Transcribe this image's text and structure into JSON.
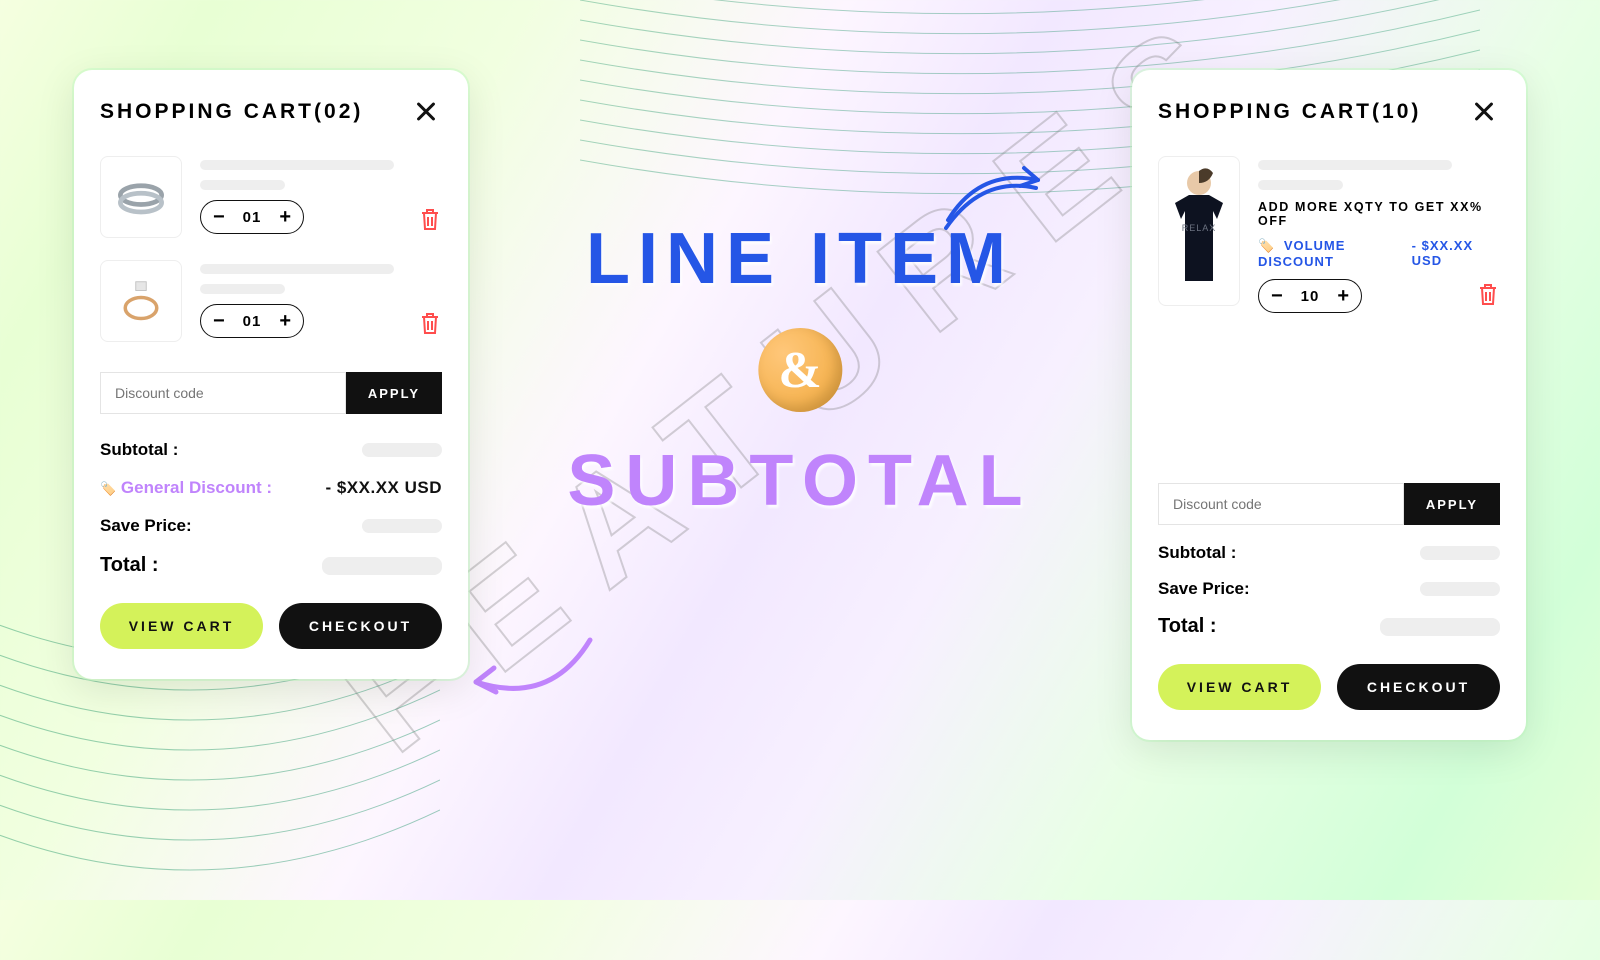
{
  "bg_watermark": "FEATURES",
  "center": {
    "line1": "LINE ITEM",
    "amp": "&",
    "line2": "SUBTOTAL"
  },
  "left": {
    "title_prefix": "SHOPPING CART",
    "count": "(02)",
    "items": [
      {
        "qty": "01"
      },
      {
        "qty": "01"
      }
    ],
    "discount_placeholder": "Discount code",
    "apply_label": "APPLY",
    "summary": {
      "subtotal_label": "Subtotal :",
      "general_discount_label": "General Discount :",
      "general_discount_value": "- $XX.XX USD",
      "save_label": "Save Price:",
      "total_label": "Total :"
    },
    "view_cart": "VIEW CART",
    "checkout": "CHECKOUT"
  },
  "right": {
    "title_prefix": "SHOPPING CART",
    "count": "(10)",
    "item": {
      "promo": "ADD MORE XQTY TO GET XX% OFF",
      "vol_label": "VOLUME DISCOUNT",
      "vol_value": "- $XX.XX USD",
      "qty": "10"
    },
    "discount_placeholder": "Discount code",
    "apply_label": "APPLY",
    "summary": {
      "subtotal_label": "Subtotal :",
      "save_label": "Save Price:",
      "total_label": "Total :"
    },
    "view_cart": "VIEW CART",
    "checkout": "CHECKOUT"
  }
}
